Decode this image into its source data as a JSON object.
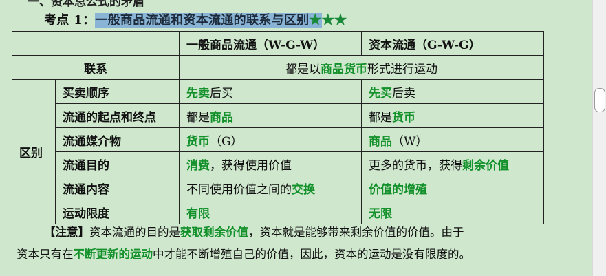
{
  "top_cut_text": "一、资本总公式的矛盾",
  "heading": {
    "prefix": "考点 1：",
    "highlighted": "一般商品流通和资本流通的联系与区别",
    "stars": [
      "★",
      "★★"
    ]
  },
  "table": {
    "headers": [
      "",
      "一般商品流通（W-G-W）",
      "资本流通（G-W-G）"
    ],
    "link_row": {
      "label": "联系",
      "parts": [
        {
          "t": "都是以",
          "g": false
        },
        {
          "t": "商品货币",
          "g": true
        },
        {
          "t": "形式进行运动",
          "g": false
        }
      ]
    },
    "diff_label": "区别",
    "rows": [
      {
        "label": "买卖顺序",
        "c1": [
          {
            "t": "先卖",
            "g": true
          },
          {
            "t": "后买",
            "g": false
          }
        ],
        "c2": [
          {
            "t": "先买",
            "g": true
          },
          {
            "t": "后卖",
            "g": false
          }
        ]
      },
      {
        "label": "流通的起点和终点",
        "c1": [
          {
            "t": "都是",
            "g": false
          },
          {
            "t": "商品",
            "g": true
          }
        ],
        "c2": [
          {
            "t": "都是",
            "g": false
          },
          {
            "t": "货币",
            "g": true
          }
        ]
      },
      {
        "label": "流通媒介物",
        "c1": [
          {
            "t": "货币",
            "g": true
          },
          {
            "t": "（G）",
            "g": false
          }
        ],
        "c2": [
          {
            "t": "商品",
            "g": true
          },
          {
            "t": "（W）",
            "g": false
          }
        ]
      },
      {
        "label": "流通目的",
        "c1": [
          {
            "t": "消费",
            "g": true
          },
          {
            "t": "，获得使用价值",
            "g": false
          }
        ],
        "c2": [
          {
            "t": "更多的货币，获得",
            "g": false
          },
          {
            "t": "剩余价值",
            "g": true
          }
        ]
      },
      {
        "label": "流通内容",
        "c1": [
          {
            "t": "不同使用价值之间的",
            "g": false
          },
          {
            "t": "交换",
            "g": true
          }
        ],
        "c2": [
          {
            "t": "价值的增殖",
            "g": true
          }
        ]
      },
      {
        "label": "运动限度",
        "c1": [
          {
            "t": "有限",
            "g": true
          }
        ],
        "c2": [
          {
            "t": "无限",
            "g": true
          }
        ]
      }
    ]
  },
  "note": {
    "line1": [
      {
        "t": "【注意】",
        "g": false,
        "b": true
      },
      {
        "t": "资本流通的目的是",
        "g": false
      },
      {
        "t": "获取剩余价值",
        "g": true
      },
      {
        "t": "，资本就是能够带来剩余价值的价值。由于",
        "g": false
      }
    ],
    "line2": [
      {
        "t": "资本只有在",
        "g": false
      },
      {
        "t": "不断更新的运动",
        "g": true
      },
      {
        "t": "中才能不断增殖自己的价值，因此，资本的运动是没有限度的。",
        "g": false
      }
    ]
  },
  "colors": {
    "page_bg": "#cfe8cd",
    "highlight": "#8ab4d6",
    "green_text": "#12902a"
  }
}
